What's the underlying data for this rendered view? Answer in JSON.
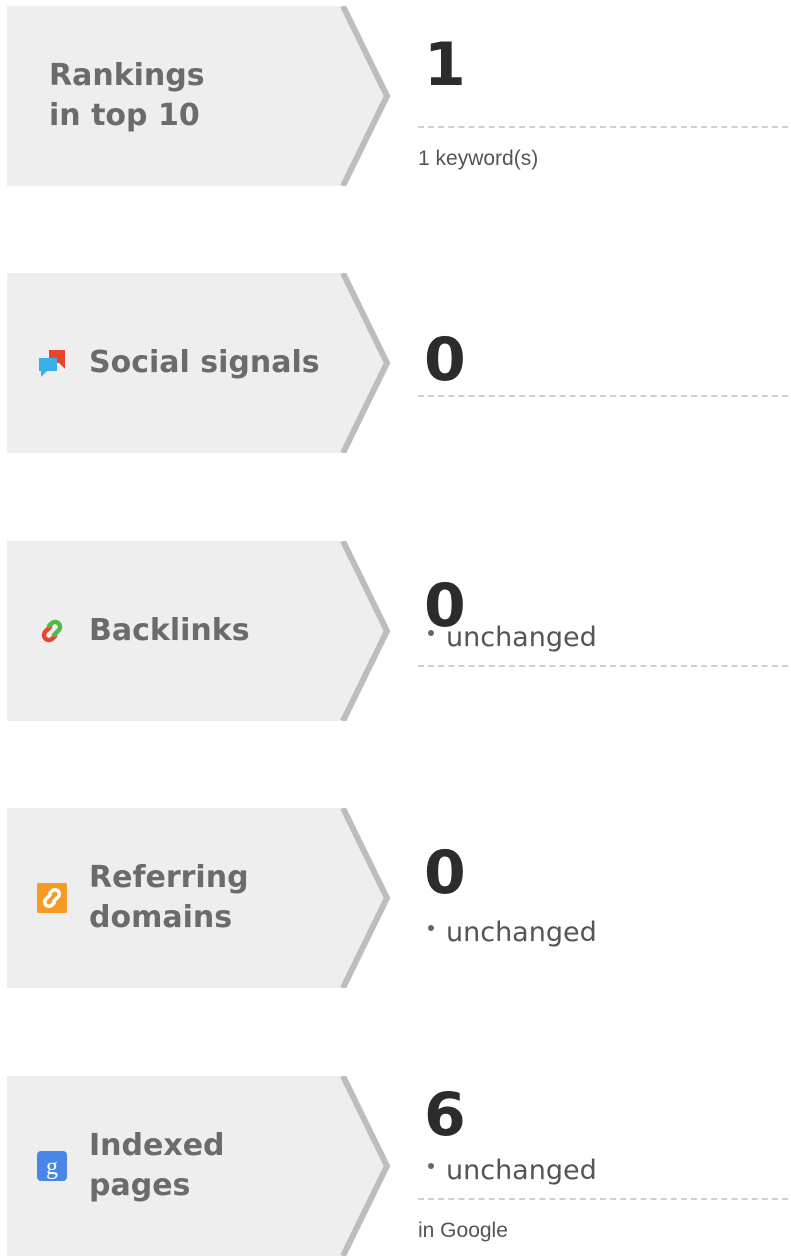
{
  "metrics": [
    {
      "label": "Rankings\nin top 10",
      "icon": "",
      "value": "1",
      "change": "",
      "sub": "1 keyword(s)"
    },
    {
      "label": "Social signals",
      "icon": "chat-bubbles-icon",
      "value": "0",
      "change": "",
      "sub": ""
    },
    {
      "label": "Backlinks",
      "icon": "link-icon",
      "value": "0",
      "change": "unchanged",
      "sub": ""
    },
    {
      "label": "Referring\ndomains",
      "icon": "domain-link-icon",
      "value": "0",
      "change": "unchanged",
      "sub": ""
    },
    {
      "label": "Indexed\npages",
      "icon": "google-icon",
      "value": "6",
      "change": "unchanged",
      "sub": "in Google"
    }
  ],
  "colors": {
    "tab_background": "#eeeeee",
    "tab_edge": "#bdbdbd",
    "label_text": "#6b6b6b",
    "value_text": "#2c2c2c",
    "divider": "#cfcfcf",
    "social_red": "#e8452c",
    "social_blue": "#3ab0e8",
    "link_red": "#e8452c",
    "link_green": "#52b848",
    "domain_orange": "#f59a23",
    "google_blue": "#4a86e8"
  }
}
